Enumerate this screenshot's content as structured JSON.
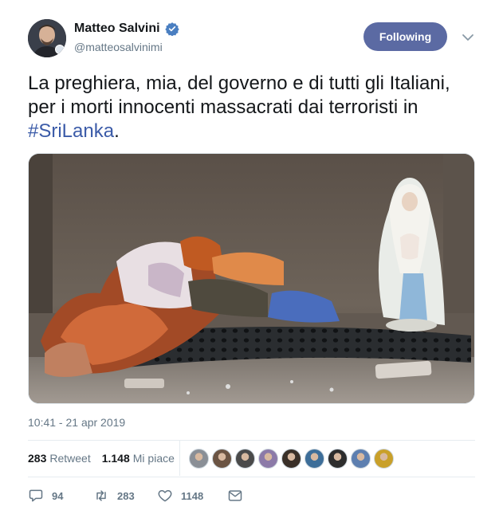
{
  "user": {
    "name": "Matteo Salvini",
    "handle": "@matteosalvinimi",
    "verified": true
  },
  "follow_button": {
    "label": "Following",
    "color": "#5b6aa3"
  },
  "tweet": {
    "text_before": "La preghiera, mia, del governo e di tutti gli Italiani, per i morti innocenti massacrati dai terroristi in ",
    "hashtag": "#SriLanka",
    "text_after": ".",
    "hashtag_color": "#3b5ba8"
  },
  "media": {
    "description_icon": "photo"
  },
  "timestamp": "10:41 - 21 apr 2019",
  "stats": {
    "retweets_count": "283",
    "retweets_label": "Retweet",
    "likes_count": "1.148",
    "likes_label": "Mi piace"
  },
  "likers": [
    {
      "icon": "avatar-1",
      "color": "#8a8f96"
    },
    {
      "icon": "avatar-2",
      "color": "#6b5443"
    },
    {
      "icon": "avatar-3",
      "color": "#4a4a4a"
    },
    {
      "icon": "avatar-4",
      "color": "#8c7aa8"
    },
    {
      "icon": "avatar-5",
      "color": "#3a3028"
    },
    {
      "icon": "avatar-6",
      "color": "#3d6e99"
    },
    {
      "icon": "avatar-7",
      "color": "#2d2d2d"
    },
    {
      "icon": "avatar-8",
      "color": "#5d7fb0"
    },
    {
      "icon": "avatar-9",
      "color": "#c9a02a"
    }
  ],
  "actions": {
    "replies": "94",
    "retweets": "283",
    "likes": "1148"
  }
}
